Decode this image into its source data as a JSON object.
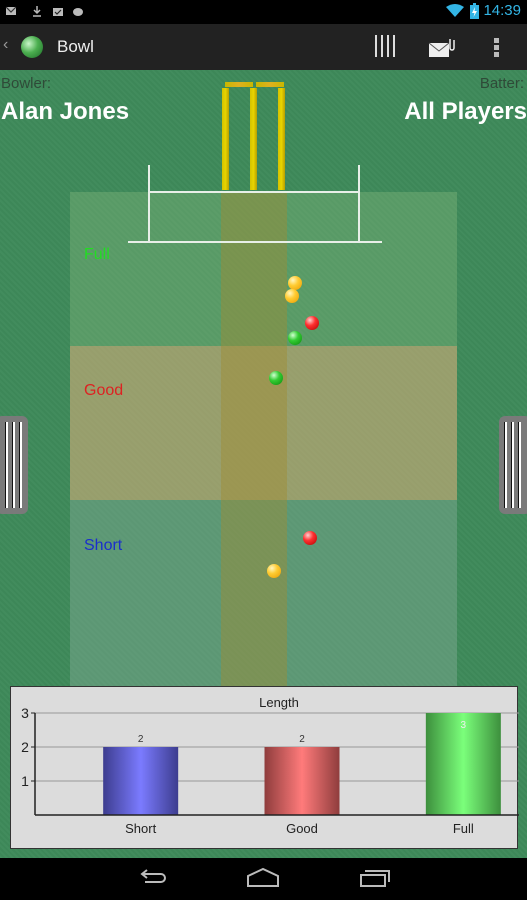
{
  "status_bar": {
    "time": "14:39",
    "left_icons": [
      "gmail-icon",
      "download-icon",
      "store-icon",
      "android-icon"
    ],
    "right_icons": [
      "wifi-icon",
      "battery-charging-icon"
    ]
  },
  "action_bar": {
    "title": "Bowl",
    "actions": [
      "stumps-icon",
      "mail-attachment-icon",
      "overflow-menu-icon"
    ]
  },
  "field": {
    "bowler_label": "Bowler:",
    "bowler_name": "Alan Jones",
    "batter_label": "Batter:",
    "batter_name": "All Players",
    "zones": {
      "full": {
        "label": "Full",
        "color": "#22dd22"
      },
      "good": {
        "label": "Good",
        "color": "#dd2222"
      },
      "short": {
        "label": "Short",
        "color": "#1a2fcc"
      }
    },
    "balls": [
      {
        "color": "yellow",
        "zone": "Full"
      },
      {
        "color": "yellow",
        "zone": "Full"
      },
      {
        "color": "red",
        "zone": "Full"
      },
      {
        "color": "green",
        "zone": "Full"
      },
      {
        "color": "green",
        "zone": "Good"
      },
      {
        "color": "red",
        "zone": "Short"
      },
      {
        "color": "yellow",
        "zone": "Short"
      }
    ]
  },
  "chart_data": {
    "type": "bar",
    "title": "Length",
    "categories": [
      "Short",
      "Good",
      "Full"
    ],
    "values": [
      2,
      2,
      3
    ],
    "data_labels": [
      "2",
      "2",
      "3"
    ],
    "colors": [
      "#7b7bff",
      "#ff7b7b",
      "#7bff7b"
    ],
    "yticks": [
      "1",
      "2",
      "3"
    ],
    "ylim": [
      0,
      3
    ],
    "xlabel": "",
    "ylabel": "",
    "grid": true
  },
  "nav_bar": {
    "buttons": [
      "back-icon",
      "home-icon",
      "recents-icon"
    ]
  }
}
